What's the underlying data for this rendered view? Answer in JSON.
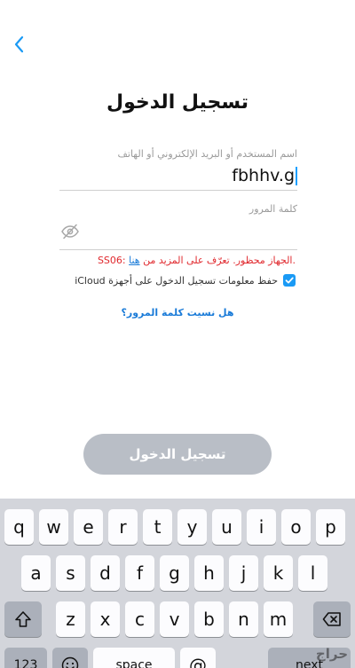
{
  "nav": {
    "back_icon": "chevron-left-icon"
  },
  "title": "تسجيل الدخول",
  "username": {
    "label": "اسم المستخدم أو البريد الإلكتروني أو الهاتف",
    "value": "fbhhv.g"
  },
  "password": {
    "label": "كلمة المرور",
    "value": "",
    "toggle_icon": "eye-slash-icon"
  },
  "error": {
    "text_before": ".الجهاز محظور. تعرّف على المزيد من ",
    "link": "هنا",
    "code": " :SS06"
  },
  "remember": {
    "label": "حفظ معلومات تسجيل الدخول على أجهزة iCloud",
    "checked": true
  },
  "forgot_password": "هل نسيت كلمة المرور؟",
  "login_button": "تسجيل الدخول",
  "keyboard": {
    "row1": [
      "q",
      "w",
      "e",
      "r",
      "t",
      "y",
      "u",
      "i",
      "o",
      "p"
    ],
    "row2": [
      "a",
      "s",
      "d",
      "f",
      "g",
      "h",
      "j",
      "k",
      "l"
    ],
    "row3": [
      "z",
      "x",
      "c",
      "v",
      "b",
      "n",
      "m"
    ],
    "numbers_key": "123",
    "space_key": "space",
    "at_key": "@",
    "next_key": "next"
  },
  "colors": {
    "accent": "#1a9af5",
    "error": "#e0282d",
    "button_disabled": "#b9bec6"
  },
  "watermark": "حراج"
}
